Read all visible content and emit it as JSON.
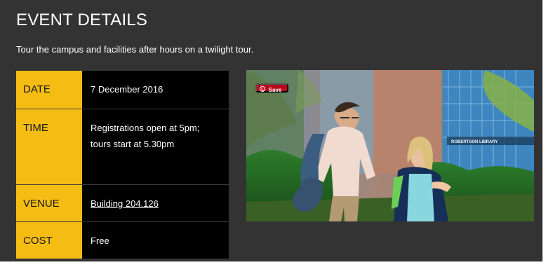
{
  "event": {
    "title": "EVENT DETAILS",
    "subtitle": "Tour the campus and facilities after hours on a twilight tour."
  },
  "details": [
    {
      "label": "DATE",
      "value": "7 December 2016"
    },
    {
      "label": "TIME",
      "value": "Registrations open at 5pm; tours start at 5.30pm"
    },
    {
      "label": "VENUE",
      "value": "Building 204.126"
    },
    {
      "label": "COST",
      "value": "Free"
    }
  ],
  "photo": {
    "save_label": "Save",
    "sign_text": "ROBERTSON LIBRARY"
  },
  "colors": {
    "panel_background": "#333333",
    "label_background": "#f5bd14",
    "details_background": "#000000",
    "save_button": "#bd081c"
  },
  "icons": {
    "save": "pinterest-save-icon"
  }
}
